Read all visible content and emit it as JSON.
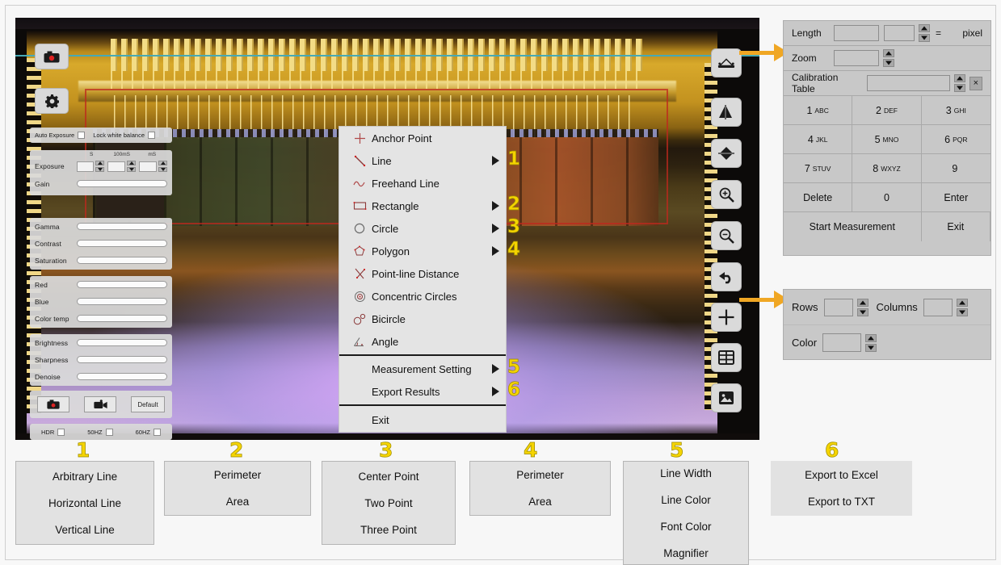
{
  "camera_overlay": {
    "capture_icon": "record-camera-icon",
    "settings_icon": "gear-icon",
    "checkbox_row": {
      "auto_exposure": "Auto Exposure",
      "lock_white_balance": "Lock white balance"
    },
    "exposure": {
      "label": "Exposure",
      "unit_labels": [
        "S",
        "100mS",
        "mS"
      ],
      "values": [
        "",
        "",
        ""
      ]
    },
    "sliders": [
      "Gain",
      "Gamma",
      "Contrast",
      "Saturation",
      "Red",
      "Blue",
      "Color temp",
      "Brightness",
      "Sharpness",
      "Denoise"
    ],
    "buttons": {
      "snapshot": "snapshot-camera-icon",
      "record": "video-camera-icon",
      "default": "Default"
    },
    "bottom_checks": [
      "HDR",
      "50HZ",
      "60HZ"
    ]
  },
  "right_toolbar": [
    {
      "name": "measure-icon"
    },
    {
      "name": "flip-horizontal-icon"
    },
    {
      "name": "flip-vertical-icon"
    },
    {
      "name": "zoom-in-icon"
    },
    {
      "name": "zoom-out-icon"
    },
    {
      "name": "undo-icon"
    },
    {
      "name": "crosshair-grid-icon"
    },
    {
      "name": "table-grid-icon"
    },
    {
      "name": "image-icon"
    }
  ],
  "context_menu": {
    "items": [
      {
        "label": "Anchor Point",
        "icon": "crosshair-icon",
        "submenu": false,
        "num": ""
      },
      {
        "label": "Line",
        "icon": "line-icon",
        "submenu": true,
        "num": "1"
      },
      {
        "label": "Freehand Line",
        "icon": "freehand-line-icon",
        "submenu": false,
        "num": ""
      },
      {
        "label": "Rectangle",
        "icon": "rectangle-icon",
        "submenu": true,
        "num": "2"
      },
      {
        "label": "Circle",
        "icon": "circle-icon",
        "submenu": true,
        "num": "3"
      },
      {
        "label": "Polygon",
        "icon": "polygon-icon",
        "submenu": true,
        "num": "4"
      },
      {
        "label": "Point-line Distance",
        "icon": "point-line-distance-icon",
        "submenu": false,
        "num": ""
      },
      {
        "label": "Concentric Circles",
        "icon": "concentric-circles-icon",
        "submenu": false,
        "num": ""
      },
      {
        "label": "Bicircle",
        "icon": "bicircle-icon",
        "submenu": false,
        "num": ""
      },
      {
        "label": "Angle",
        "icon": "angle-icon",
        "submenu": false,
        "num": ""
      }
    ],
    "group2": [
      {
        "label": "Measurement Setting",
        "submenu": true,
        "num": "5"
      },
      {
        "label": "Export Results",
        "submenu": true,
        "num": "6"
      }
    ],
    "exit": {
      "label": "Exit"
    }
  },
  "measure_panel": {
    "length": {
      "label": "Length",
      "value1": "",
      "value2": "",
      "equals": "=",
      "unit": "pixel"
    },
    "zoom": {
      "label": "Zoom",
      "value": ""
    },
    "calibration": {
      "label": "Calibration Table",
      "value": "",
      "clear": "×"
    },
    "keypad": [
      {
        "digit": "1",
        "letters": "ABC"
      },
      {
        "digit": "2",
        "letters": "DEF"
      },
      {
        "digit": "3",
        "letters": "GHI"
      },
      {
        "digit": "4",
        "letters": "JKL"
      },
      {
        "digit": "5",
        "letters": "MNO"
      },
      {
        "digit": "6",
        "letters": "PQR"
      },
      {
        "digit": "7",
        "letters": "STUV"
      },
      {
        "digit": "8",
        "letters": "WXYZ"
      },
      {
        "digit": "9",
        "letters": ""
      },
      {
        "digit": "Delete",
        "letters": ""
      },
      {
        "digit": "0",
        "letters": ""
      },
      {
        "digit": "Enter",
        "letters": ""
      }
    ],
    "start": "Start  Measurement",
    "exit": "Exit"
  },
  "grid_panel": {
    "rows": {
      "label": "Rows",
      "value": ""
    },
    "columns": {
      "label": "Columns",
      "value": ""
    },
    "color": {
      "label": "Color",
      "value": ""
    }
  },
  "callouts": [
    {
      "num": "1",
      "items": [
        "Arbitrary Line",
        "Horizontal Line",
        "Vertical Line"
      ]
    },
    {
      "num": "2",
      "items": [
        "Perimeter",
        "Area"
      ]
    },
    {
      "num": "3",
      "items": [
        "Center Point",
        "Two Point",
        "Three Point"
      ]
    },
    {
      "num": "4",
      "items": [
        "Perimeter",
        "Area"
      ]
    },
    {
      "num": "5",
      "items": [
        "Line Width",
        "Line Color",
        "Font Color",
        "Magnifier"
      ]
    },
    {
      "num": "6",
      "items": [
        "Export to Excel",
        "Export to TXT"
      ]
    }
  ],
  "colors": {
    "callout_yellow": "#f5d400",
    "arrow_orange": "#f0a724",
    "panel_gray": "#c8c8c8",
    "guide_cyan": "#46a9b5"
  }
}
